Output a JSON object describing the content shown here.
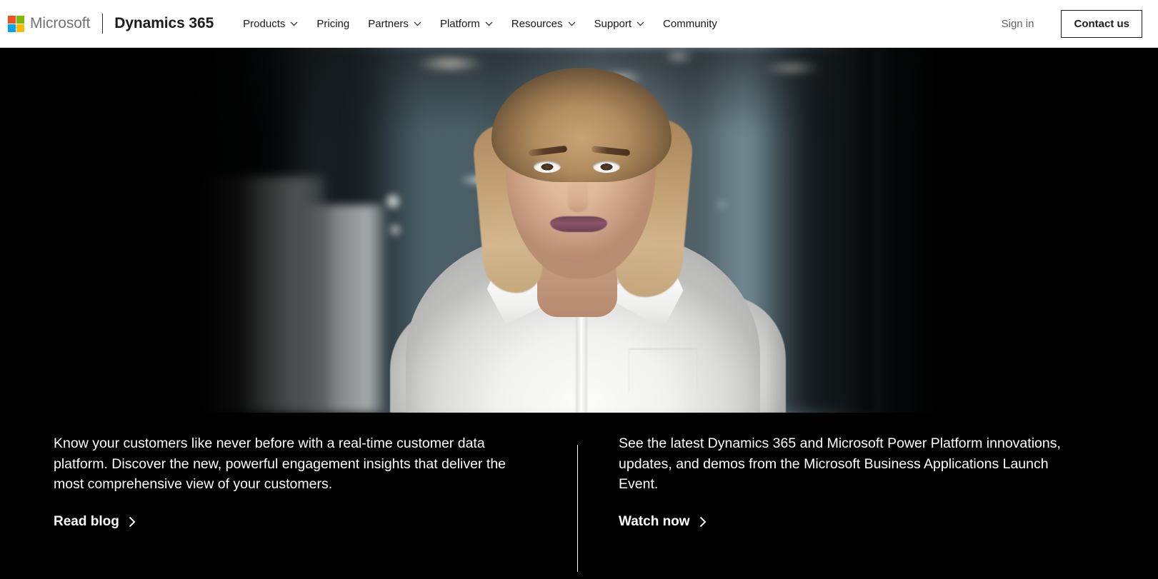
{
  "nav": {
    "logo_name": "microsoft-logo",
    "company": "Microsoft",
    "product": "Dynamics 365",
    "items": [
      {
        "label": "Products",
        "has_caret": true
      },
      {
        "label": "Pricing",
        "has_caret": false
      },
      {
        "label": "Partners",
        "has_caret": true
      },
      {
        "label": "Platform",
        "has_caret": true
      },
      {
        "label": "Resources",
        "has_caret": true
      },
      {
        "label": "Support",
        "has_caret": true
      },
      {
        "label": "Community",
        "has_caret": false
      }
    ],
    "sign_in": "Sign in",
    "contact": "Contact us"
  },
  "hero": {
    "alt": "Woman in a white blouse standing in a modern office with blurred glass partitions"
  },
  "promos": {
    "left": {
      "body": "Know your customers like never before with a real-time customer data platform. Discover the new, powerful engagement insights that deliver the most comprehensive view of your customers.",
      "cta": "Read blog",
      "cta_icon": "chevron-right-icon"
    },
    "right": {
      "body": "See the latest Dynamics 365 and Microsoft Power Platform innovations, updates, and demos from the Microsoft Business Applications Launch Event.",
      "cta": "Watch now",
      "cta_icon": "chevron-right-icon"
    }
  },
  "colors": {
    "page_background": "#000000",
    "nav_background": "#ffffff",
    "nav_text": "#171717",
    "sign_in_text": "#616161",
    "promo_text": "#ffffff",
    "ms_red": "#f25022",
    "ms_green": "#7fba00",
    "ms_blue": "#00a4ef",
    "ms_yellow": "#ffb900"
  }
}
